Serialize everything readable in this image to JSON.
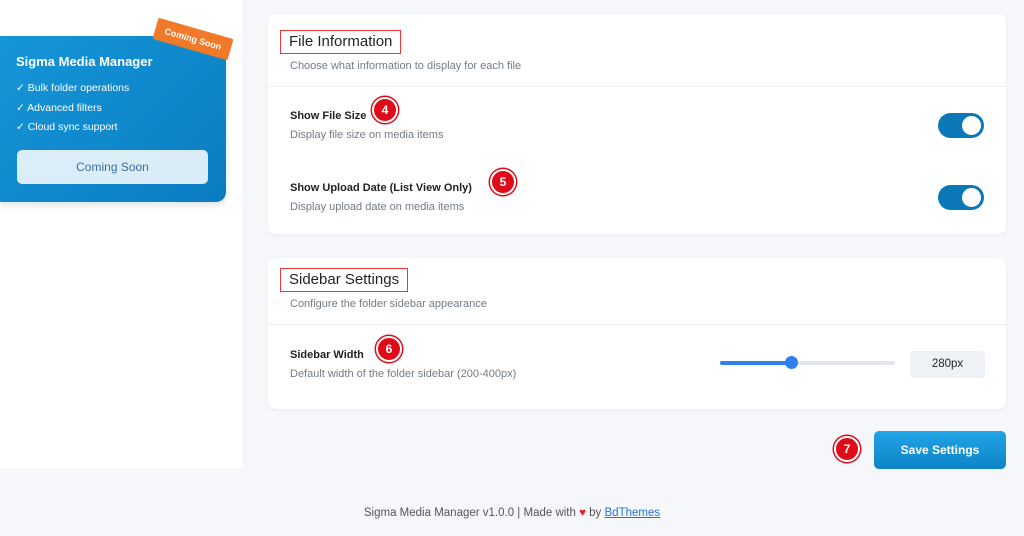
{
  "promo": {
    "title": "Sigma Media Manager",
    "badge": "Coming Soon",
    "features": [
      "✓ Bulk folder operations",
      "✓ Advanced filters",
      "✓ Cloud sync support"
    ],
    "button_label": "Coming Soon"
  },
  "file_info": {
    "title": "File Information",
    "description": "Choose what information to display for each file",
    "settings": [
      {
        "label": "Show File Size",
        "description": "Display file size on media items",
        "marker": "4",
        "enabled": true
      },
      {
        "label": "Show Upload Date (List View Only)",
        "description": "Display upload date on media items",
        "marker": "5",
        "enabled": true
      }
    ]
  },
  "sidebar_settings": {
    "title": "Sidebar Settings",
    "description": "Configure the folder sidebar appearance",
    "width": {
      "label": "Sidebar Width",
      "description": "Default width of the folder sidebar (200-400px)",
      "marker": "6",
      "value": "280px"
    }
  },
  "actions": {
    "save_label": "Save Settings",
    "marker": "7"
  },
  "footer": {
    "text": "Sigma Media Manager v1.0.0 | Made with",
    "heart": "♥",
    "by": "by",
    "link": "BdThemes"
  },
  "colors": {
    "accent": "#0b79b8",
    "marker": "#e00b18",
    "badge": "#f07a2a"
  }
}
